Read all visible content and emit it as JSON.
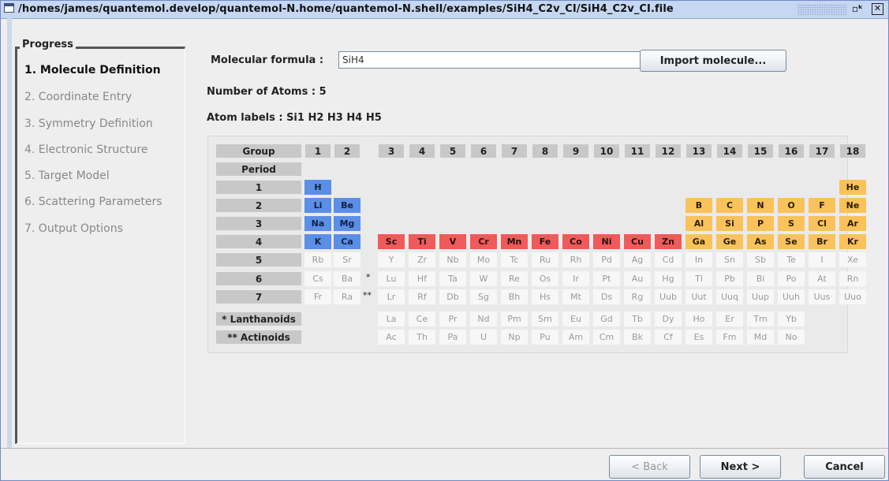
{
  "window": {
    "title": "/homes/james/quantemol.develop/quantemol-N.home/quantemol-N.shell/examples/SiH4_C2v_CI/SiH4_C2v_CI.file",
    "min_glyph": "▫ᵏ",
    "close_glyph": "✕"
  },
  "sidebar": {
    "header": "Progress",
    "steps": [
      {
        "label": "1. Molecule Definition",
        "active": true
      },
      {
        "label": "2. Coordinate Entry",
        "active": false
      },
      {
        "label": "3. Symmetry Definition",
        "active": false
      },
      {
        "label": "4. Electronic Structure",
        "active": false
      },
      {
        "label": "5. Target Model",
        "active": false
      },
      {
        "label": "6. Scattering Parameters",
        "active": false
      },
      {
        "label": "7. Output Options",
        "active": false
      }
    ]
  },
  "form": {
    "formula_label": "Molecular formula :",
    "formula_value": "SiH4",
    "import_button": "Import molecule...",
    "atoms_text": "Number of Atoms : 5",
    "labels_text": "Atom labels : Si1 H2 H3 H4 H5"
  },
  "periodic": {
    "group_label": "Group",
    "period_label": "Period",
    "groups": [
      "1",
      "2",
      "3",
      "4",
      "5",
      "6",
      "7",
      "8",
      "9",
      "10",
      "11",
      "12",
      "13",
      "14",
      "15",
      "16",
      "17",
      "18"
    ],
    "periods": [
      "1",
      "2",
      "3",
      "4",
      "5",
      "6",
      "7"
    ],
    "lanthanoids_label": "* Lanthanoids",
    "actinoids_label": "** Actinoids",
    "period6_mark": "*",
    "period7_mark": "**",
    "rows": [
      [
        [
          "H",
          1,
          "s"
        ],
        [
          "He",
          18,
          "p"
        ]
      ],
      [
        [
          "Li",
          1,
          "s"
        ],
        [
          "Be",
          2,
          "s"
        ],
        [
          "B",
          13,
          "p"
        ],
        [
          "C",
          14,
          "p"
        ],
        [
          "N",
          15,
          "p"
        ],
        [
          "O",
          16,
          "p"
        ],
        [
          "F",
          17,
          "p"
        ],
        [
          "Ne",
          18,
          "p"
        ]
      ],
      [
        [
          "Na",
          1,
          "s"
        ],
        [
          "Mg",
          2,
          "s"
        ],
        [
          "Al",
          13,
          "p"
        ],
        [
          "Si",
          14,
          "p"
        ],
        [
          "P",
          15,
          "p"
        ],
        [
          "S",
          16,
          "p"
        ],
        [
          "Cl",
          17,
          "p"
        ],
        [
          "Ar",
          18,
          "p"
        ]
      ],
      [
        [
          "K",
          1,
          "s"
        ],
        [
          "Ca",
          2,
          "s"
        ],
        [
          "Sc",
          3,
          "d"
        ],
        [
          "Ti",
          4,
          "d"
        ],
        [
          "V",
          5,
          "d"
        ],
        [
          "Cr",
          6,
          "d"
        ],
        [
          "Mn",
          7,
          "d"
        ],
        [
          "Fe",
          8,
          "d"
        ],
        [
          "Co",
          9,
          "d"
        ],
        [
          "Ni",
          10,
          "d"
        ],
        [
          "Cu",
          11,
          "d"
        ],
        [
          "Zn",
          12,
          "d"
        ],
        [
          "Ga",
          13,
          "p"
        ],
        [
          "Ge",
          14,
          "p"
        ],
        [
          "As",
          15,
          "p"
        ],
        [
          "Se",
          16,
          "p"
        ],
        [
          "Br",
          17,
          "p"
        ],
        [
          "Kr",
          18,
          "p"
        ]
      ],
      [
        [
          "Rb",
          1,
          "dim"
        ],
        [
          "Sr",
          2,
          "dim"
        ],
        [
          "Y",
          3,
          "dim"
        ],
        [
          "Zr",
          4,
          "dim"
        ],
        [
          "Nb",
          5,
          "dim"
        ],
        [
          "Mo",
          6,
          "dim"
        ],
        [
          "Tc",
          7,
          "dim"
        ],
        [
          "Ru",
          8,
          "dim"
        ],
        [
          "Rh",
          9,
          "dim"
        ],
        [
          "Pd",
          10,
          "dim"
        ],
        [
          "Ag",
          11,
          "dim"
        ],
        [
          "Cd",
          12,
          "dim"
        ],
        [
          "In",
          13,
          "dim"
        ],
        [
          "Sn",
          14,
          "dim"
        ],
        [
          "Sb",
          15,
          "dim"
        ],
        [
          "Te",
          16,
          "dim"
        ],
        [
          "I",
          17,
          "dim"
        ],
        [
          "Xe",
          18,
          "dim"
        ]
      ],
      [
        [
          "Cs",
          1,
          "dim"
        ],
        [
          "Ba",
          2,
          "dim"
        ],
        [
          "Lu",
          3,
          "dim"
        ],
        [
          "Hf",
          4,
          "dim"
        ],
        [
          "Ta",
          5,
          "dim"
        ],
        [
          "W",
          6,
          "dim"
        ],
        [
          "Re",
          7,
          "dim"
        ],
        [
          "Os",
          8,
          "dim"
        ],
        [
          "Ir",
          9,
          "dim"
        ],
        [
          "Pt",
          10,
          "dim"
        ],
        [
          "Au",
          11,
          "dim"
        ],
        [
          "Hg",
          12,
          "dim"
        ],
        [
          "Tl",
          13,
          "dim"
        ],
        [
          "Pb",
          14,
          "dim"
        ],
        [
          "Bi",
          15,
          "dim"
        ],
        [
          "Po",
          16,
          "dim"
        ],
        [
          "At",
          17,
          "dim"
        ],
        [
          "Rn",
          18,
          "dim"
        ]
      ],
      [
        [
          "Fr",
          1,
          "dim"
        ],
        [
          "Ra",
          2,
          "dim"
        ],
        [
          "Lr",
          3,
          "dim"
        ],
        [
          "Rf",
          4,
          "dim"
        ],
        [
          "Db",
          5,
          "dim"
        ],
        [
          "Sg",
          6,
          "dim"
        ],
        [
          "Bh",
          7,
          "dim"
        ],
        [
          "Hs",
          8,
          "dim"
        ],
        [
          "Mt",
          9,
          "dim"
        ],
        [
          "Ds",
          10,
          "dim"
        ],
        [
          "Rg",
          11,
          "dim"
        ],
        [
          "Uub",
          12,
          "dim"
        ],
        [
          "Uut",
          13,
          "dim"
        ],
        [
          "Uuq",
          14,
          "dim"
        ],
        [
          "Uup",
          15,
          "dim"
        ],
        [
          "Uuh",
          16,
          "dim"
        ],
        [
          "Uus",
          17,
          "dim"
        ],
        [
          "Uuo",
          18,
          "dim"
        ]
      ]
    ],
    "lanthanoids": [
      "La",
      "Ce",
      "Pr",
      "Nd",
      "Pm",
      "Sm",
      "Eu",
      "Gd",
      "Tb",
      "Dy",
      "Ho",
      "Er",
      "Tm",
      "Yb"
    ],
    "actinoids": [
      "Ac",
      "Th",
      "Pa",
      "U",
      "Np",
      "Pu",
      "Am",
      "Cm",
      "Bk",
      "Cf",
      "Es",
      "Fm",
      "Md",
      "No"
    ]
  },
  "footer": {
    "back": "< Back",
    "next": "Next >",
    "cancel": "Cancel"
  },
  "colors": {
    "s_block": "#5b8fe6",
    "d_block": "#f05a5a",
    "p_block": "#f9c25a",
    "titlebar": "#c5d7f1"
  }
}
